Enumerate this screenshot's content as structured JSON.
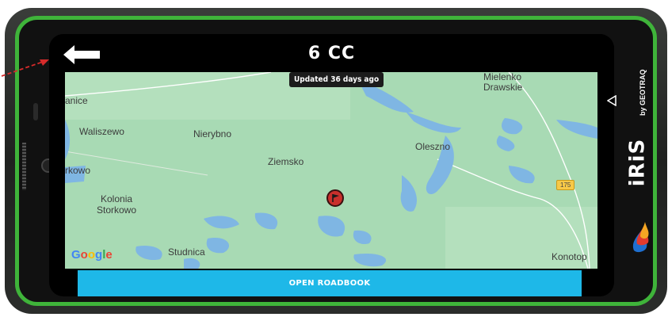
{
  "header": {
    "title": "6 CC",
    "back_icon": "arrow-left-icon"
  },
  "map": {
    "updated_badge": "Updated 36 days ago",
    "road_number": "175",
    "attribution": "Google",
    "places": [
      {
        "name": "Mielenko\nDrawskie"
      },
      {
        "name": "anice"
      },
      {
        "name": "Waliszewo"
      },
      {
        "name": "Nierybno"
      },
      {
        "name": "Oleszno"
      },
      {
        "name": "Ziemsko"
      },
      {
        "name": "rkowo"
      },
      {
        "name": "Kolonia\nStorkowo"
      },
      {
        "name": "Studnica"
      },
      {
        "name": "Konotop"
      }
    ],
    "marker_icon": "flag-pin-icon"
  },
  "actions": {
    "open_roadbook": "OPEN ROADBOOK"
  },
  "device": {
    "brand": "iRiS",
    "brand_sub": "by GEOTRAQ",
    "nav_back_icon": "triangle-back-icon"
  },
  "colors": {
    "bezel_green": "#3fb43a",
    "map_green": "#a8dab4",
    "water": "#7fb6e3",
    "button_blue": "#1eb8e8",
    "marker_red": "#c9302c"
  }
}
